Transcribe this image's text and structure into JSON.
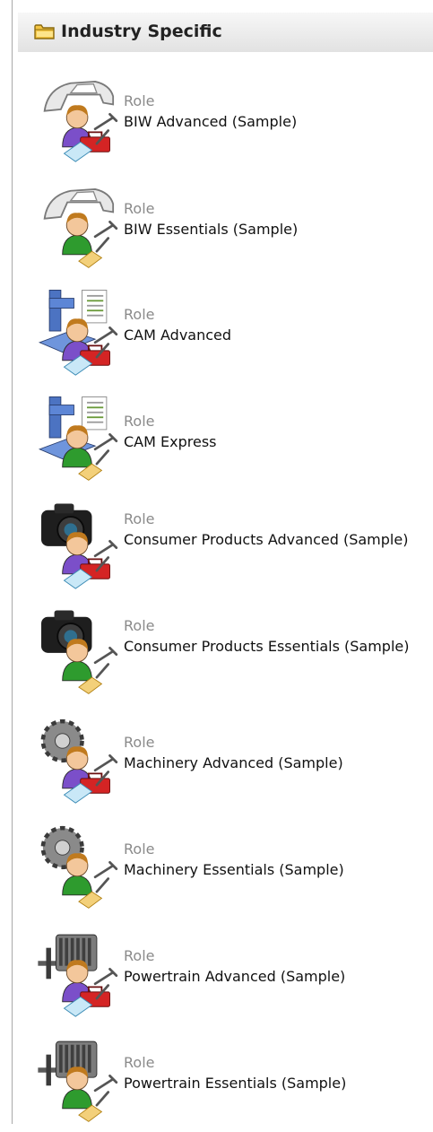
{
  "header": {
    "title": "Industry Specific",
    "icon": "folder-icon"
  },
  "roles": [
    {
      "type": "Role",
      "name": "BIW Advanced (Sample)",
      "subject": "car-body",
      "level": "advanced"
    },
    {
      "type": "Role",
      "name": "BIW Essentials (Sample)",
      "subject": "car-body",
      "level": "essentials"
    },
    {
      "type": "Role",
      "name": "CAM Advanced",
      "subject": "cam-machine",
      "level": "advanced"
    },
    {
      "type": "Role",
      "name": "CAM Express",
      "subject": "cam-machine",
      "level": "essentials"
    },
    {
      "type": "Role",
      "name": "Consumer Products Advanced (Sample)",
      "subject": "camera",
      "level": "advanced"
    },
    {
      "type": "Role",
      "name": "Consumer Products Essentials (Sample)",
      "subject": "camera",
      "level": "essentials"
    },
    {
      "type": "Role",
      "name": "Machinery Advanced (Sample)",
      "subject": "gear",
      "level": "advanced"
    },
    {
      "type": "Role",
      "name": "Machinery Essentials (Sample)",
      "subject": "gear",
      "level": "essentials"
    },
    {
      "type": "Role",
      "name": "Powertrain Advanced (Sample)",
      "subject": "engine",
      "level": "advanced"
    },
    {
      "type": "Role",
      "name": "Powertrain Essentials (Sample)",
      "subject": "engine",
      "level": "essentials"
    }
  ],
  "colors": {
    "advanced_person_shirt": "#7b4fc9",
    "essentials_person_shirt": "#2e9b2e",
    "toolbox_red": "#d42424",
    "muted_label": "#8a8a8a"
  }
}
